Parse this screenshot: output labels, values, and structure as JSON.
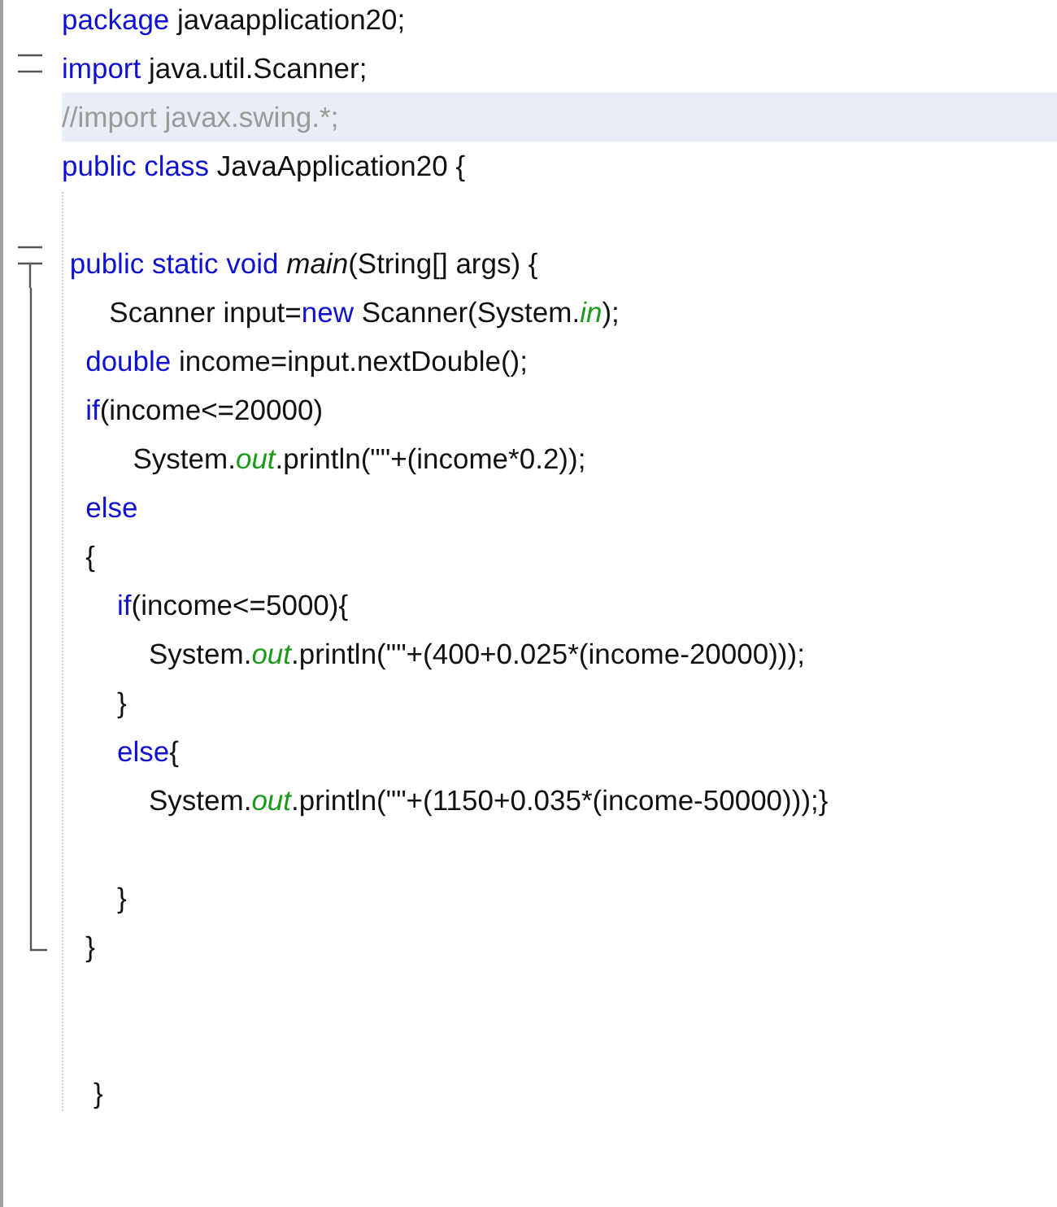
{
  "editor": {
    "lines": [
      {
        "kind": "plain",
        "highlighted": false,
        "tokens": [
          {
            "kind": "kw",
            "text": "package"
          },
          {
            "kind": "text",
            "text": " javaapplication20;"
          }
        ]
      },
      {
        "kind": "collapsible",
        "highlighted": false,
        "tokens": [
          {
            "kind": "kw",
            "text": "import"
          },
          {
            "kind": "text",
            "text": " java.util.Scanner;"
          }
        ]
      },
      {
        "kind": "plain",
        "highlighted": true,
        "tokens": [
          {
            "kind": "comment",
            "text": "//import javax.swing.*;"
          }
        ]
      },
      {
        "kind": "plain",
        "highlighted": false,
        "tokens": [
          {
            "kind": "kw",
            "text": "public class"
          },
          {
            "kind": "text",
            "text": " JavaApplication20 {"
          }
        ]
      },
      {
        "kind": "plain",
        "highlighted": false
      },
      {
        "kind": "opener",
        "highlighted": false,
        "tokens": [
          {
            "kind": "kw",
            "text": " public static void "
          },
          {
            "kind": "method",
            "text": "main"
          },
          {
            "kind": "text",
            "text": "(String[] args) {"
          }
        ]
      },
      {
        "kind": "body",
        "highlighted": false,
        "tokens": [
          {
            "kind": "text",
            "text": "      Scanner input="
          },
          {
            "kind": "kw",
            "text": "new"
          },
          {
            "kind": "text",
            "text": " Scanner(System."
          },
          {
            "kind": "field",
            "text": "in"
          },
          {
            "kind": "text",
            "text": ");"
          }
        ]
      },
      {
        "kind": "body",
        "highlighted": false,
        "tokens": [
          {
            "kind": "kw",
            "text": "   double"
          },
          {
            "kind": "text",
            "text": " income=input.nextDouble();"
          }
        ]
      },
      {
        "kind": "body",
        "highlighted": false,
        "tokens": [
          {
            "kind": "kw",
            "text": "   if"
          },
          {
            "kind": "text",
            "text": "(income<=20000)"
          }
        ]
      },
      {
        "kind": "body",
        "highlighted": false,
        "tokens": [
          {
            "kind": "text",
            "text": "         System."
          },
          {
            "kind": "field",
            "text": "out"
          },
          {
            "kind": "text",
            "text": ".println(\"\"+(income*0.2));"
          }
        ]
      },
      {
        "kind": "body",
        "highlighted": false,
        "tokens": [
          {
            "kind": "kw",
            "text": "   else"
          }
        ]
      },
      {
        "kind": "body",
        "highlighted": false,
        "tokens": [
          {
            "kind": "text",
            "text": "   {"
          }
        ]
      },
      {
        "kind": "body",
        "highlighted": false,
        "tokens": [
          {
            "kind": "kw",
            "text": "       if"
          },
          {
            "kind": "text",
            "text": "(income<=5000){"
          }
        ]
      },
      {
        "kind": "body",
        "highlighted": false,
        "tokens": [
          {
            "kind": "text",
            "text": "           System."
          },
          {
            "kind": "field",
            "text": "out"
          },
          {
            "kind": "text",
            "text": ".println(\"\"+(400+0.025*(income-20000)));"
          }
        ]
      },
      {
        "kind": "body",
        "highlighted": false,
        "tokens": [
          {
            "kind": "text",
            "text": "       }"
          }
        ]
      },
      {
        "kind": "body",
        "highlighted": false,
        "tokens": [
          {
            "kind": "kw",
            "text": "       else"
          },
          {
            "kind": "text",
            "text": "{"
          }
        ]
      },
      {
        "kind": "body",
        "highlighted": false,
        "tokens": [
          {
            "kind": "text",
            "text": "           System."
          },
          {
            "kind": "field",
            "text": "out"
          },
          {
            "kind": "text",
            "text": ".println(\"\"+(1150+0.035*(income-50000)));}"
          }
        ]
      },
      {
        "kind": "body",
        "highlighted": false
      },
      {
        "kind": "body",
        "highlighted": false,
        "tokens": [
          {
            "kind": "text",
            "text": "       }"
          }
        ]
      },
      {
        "kind": "closer",
        "highlighted": false,
        "tokens": [
          {
            "kind": "text",
            "text": "   }"
          }
        ]
      },
      {
        "kind": "plain",
        "highlighted": false
      },
      {
        "kind": "plain",
        "highlighted": false
      },
      {
        "kind": "plain",
        "highlighted": false,
        "tokens": [
          {
            "kind": "text",
            "text": "    }"
          }
        ]
      }
    ]
  }
}
